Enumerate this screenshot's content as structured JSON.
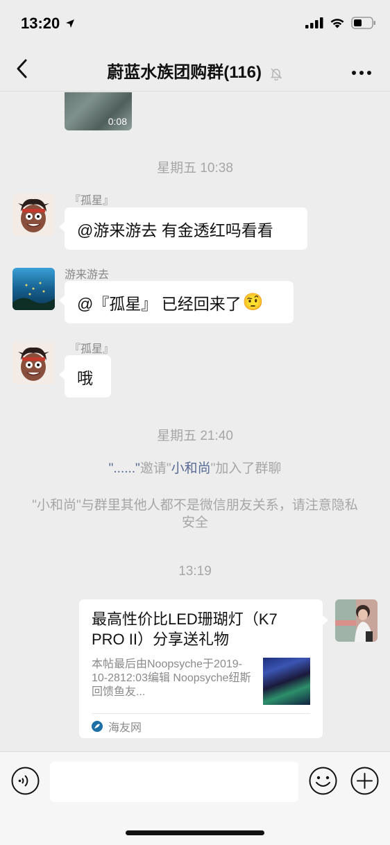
{
  "status_bar": {
    "time": "13:20"
  },
  "header": {
    "title": "蔚蓝水族团购群(116)"
  },
  "chat": {
    "video": {
      "duration": "0:08"
    },
    "messages": [
      {
        "type": "timestamp",
        "text": "星期五 10:38"
      },
      {
        "type": "text",
        "sender": "『孤星』",
        "text": "@游来游去 有金透红吗看看"
      },
      {
        "type": "text",
        "sender": "游来游去",
        "text": "@『孤星』 已经回来了",
        "emoji": "🤨"
      },
      {
        "type": "text",
        "sender": "『孤星』",
        "text": "哦"
      },
      {
        "type": "timestamp",
        "text": "星期五 21:40"
      },
      {
        "type": "system",
        "parts": {
          "inviter": "\"......\"",
          "invite_verb": "邀请",
          "invitee_open": "\"",
          "invitee": "小和尚",
          "invite_suffix": "\"加入了群聊"
        }
      },
      {
        "type": "system",
        "text": "\"小和尚\"与群里其他人都不是微信朋友关系，请注意隐私安全"
      },
      {
        "type": "timestamp",
        "text": "13:19"
      }
    ],
    "link_card": {
      "title": "最高性价比LED珊瑚灯（K7 PRO II）分享送礼物",
      "description": "本帖最后由Noopsyche于2019-10-2812:03编辑 Noopsyche纽斯回馈鱼友...",
      "source": "海友网",
      "source_icon": "leaf-logo-icon"
    }
  },
  "input_bar": {
    "placeholder": "",
    "icons": [
      "voice-icon",
      "emoji-icon",
      "plus-icon"
    ]
  },
  "colors": {
    "background": "#ededed",
    "link": "#576b95",
    "system_text": "#a6a6a6"
  }
}
